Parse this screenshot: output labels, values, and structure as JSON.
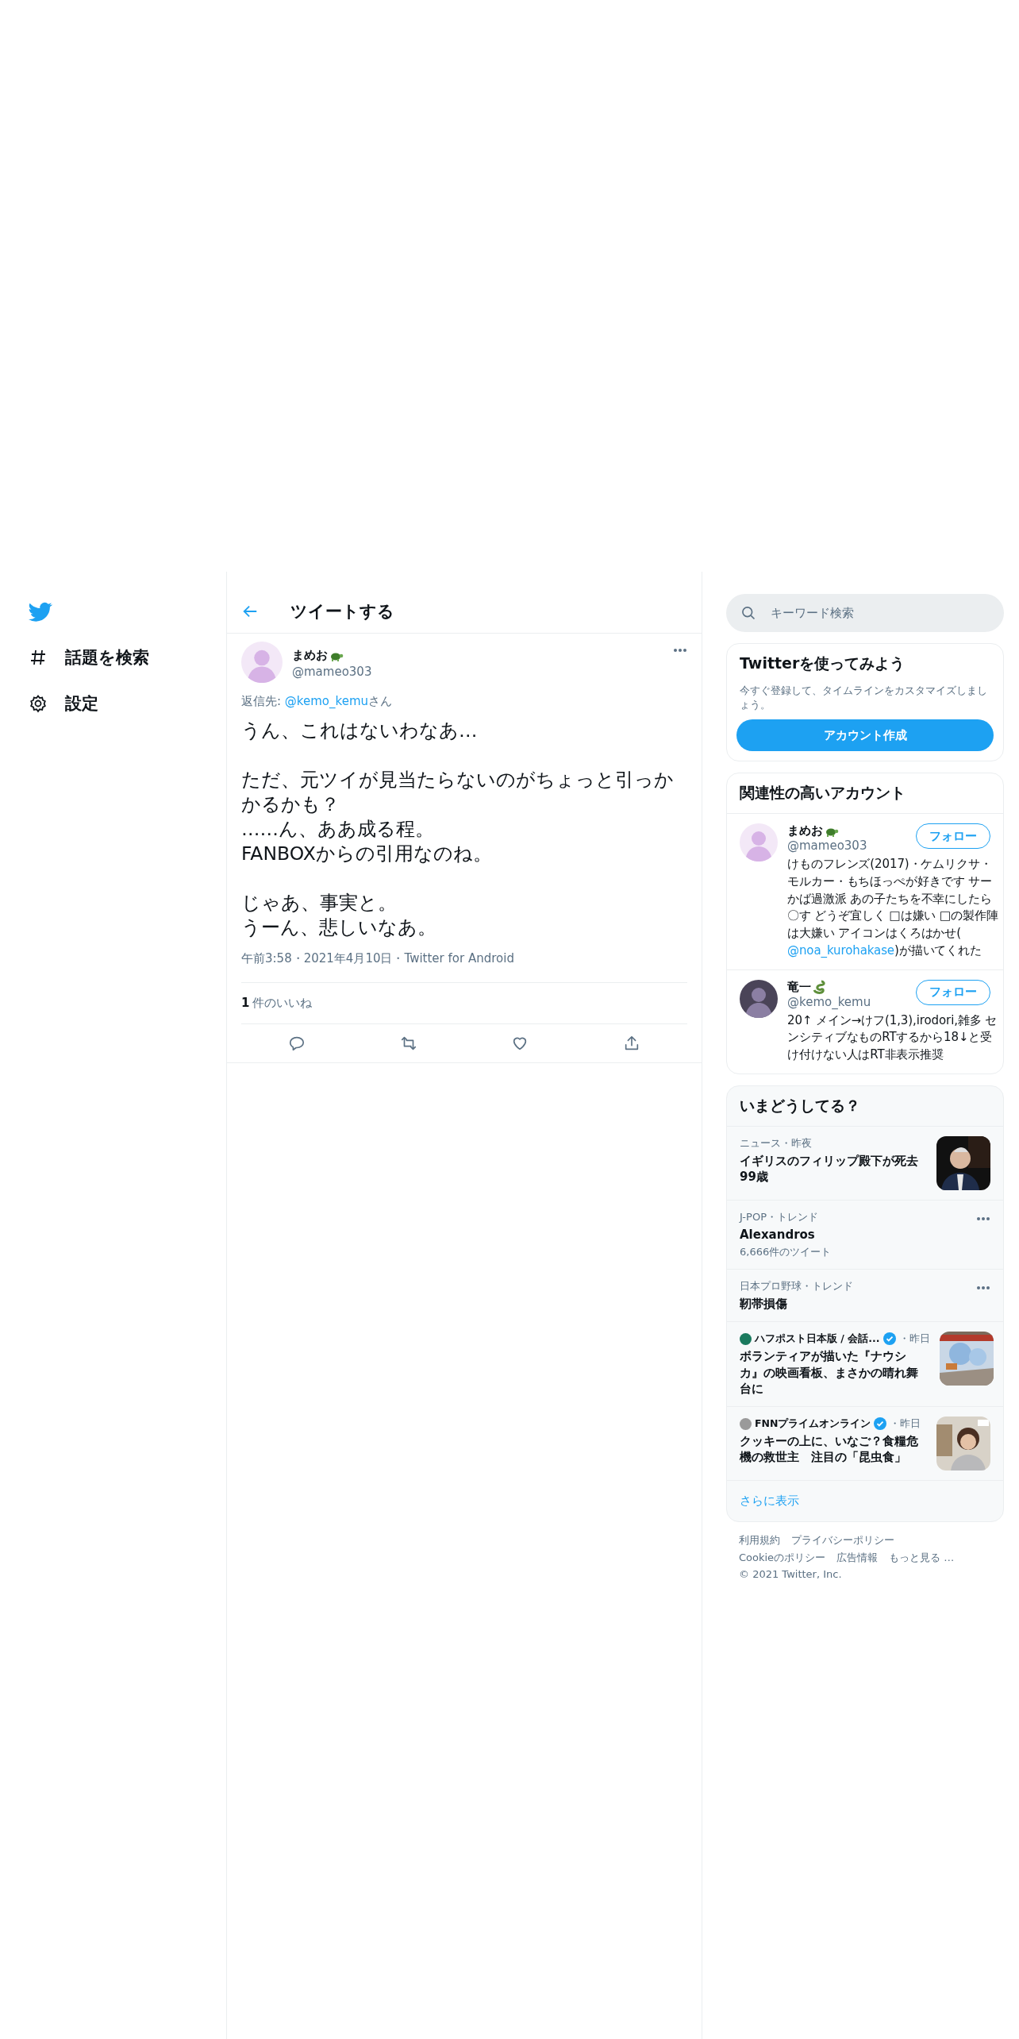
{
  "nav": {
    "items": [
      {
        "kind": "hashtag",
        "label": "話題を検索"
      },
      {
        "kind": "gear",
        "label": "設定"
      }
    ]
  },
  "header": {
    "title": "ツイートする"
  },
  "tweet": {
    "author": {
      "name": "まめお",
      "handle": "@mameo303"
    },
    "reply_to": {
      "prefix": "返信先: ",
      "handle": "@kemo_kemu",
      "suffix": "さん"
    },
    "paragraphs": [
      [
        "うん、これはないわなあ…"
      ],
      [
        "ただ、元ツイが見当たらないのがちょっと引っかかるかも？",
        "……ん、ああ成る程。",
        "FANBOXからの引用なのね。"
      ],
      [
        "じゃあ、事実と。",
        "うーん、悲しいなあ。"
      ]
    ],
    "meta": "午前3:58・2021年4月10日・Twitter for Android",
    "likes": {
      "count": "1",
      "label": "件のいいね"
    }
  },
  "search": {
    "placeholder": "キーワード検索"
  },
  "signup": {
    "title": "Twitterを使ってみよう",
    "text": "今すぐ登録して、タイムラインをカスタマイズしましょう。",
    "button": "アカウント作成"
  },
  "related": {
    "title": "関連性の高いアカウント",
    "accounts": [
      {
        "name": "まめお",
        "handle": "@mameo303",
        "follow": "フォロー",
        "bio": {
          "text": "けものフレンズ(2017)・ケムリクサ・モルカー・もちほっぺが好きです サーかば過激派 あの子たちを不幸にしたら〇す どうぞ宜しく □は嫌い □の製作陣は大嫌い アイコンはくろはかせ(",
          "mention": "@noa_kurohakase",
          "after": ")が描いてくれた"
        }
      },
      {
        "name": "竜一",
        "handle": "@kemo_kemu",
        "follow": "フォロー",
        "bio": {
          "text": "20↑ メイン→けフ(1,3),irodori,雑多 センシティブなものRTするから18↓と受け付けない人はRT非表示推奨"
        }
      }
    ]
  },
  "trends": {
    "title": "いまどうしてる？",
    "items": [
      {
        "kind": "news",
        "context": "ニュース・昨夜",
        "title": "イギリスのフィリップ殿下が死去 99歳"
      },
      {
        "kind": "trend",
        "context": "J-POP・トレンド",
        "title": "Alexandros",
        "count": "6,666件のツイート"
      },
      {
        "kind": "trend",
        "context": "日本プロ野球・トレンド",
        "title": "靭帯損傷"
      },
      {
        "kind": "article",
        "source": "ハフポスト日本版 / 会話...",
        "color": "#1a7a5e",
        "verified": true,
        "time": "・昨日",
        "title": "ボランティアが描いた『ナウシカ』の映画看板、まさかの晴れ舞台に"
      },
      {
        "kind": "article",
        "source": "FNNプライムオンライン",
        "color": "#9a9a9a",
        "verified": true,
        "time": "・昨日",
        "title": "クッキーの上に、いなご？食糧危機の救世主　注目の「昆虫食」"
      }
    ],
    "more": "さらに表示"
  },
  "footer": {
    "rows": [
      [
        "利用規約",
        "プライバシーポリシー"
      ],
      [
        "Cookieのポリシー",
        "広告情報",
        "もっと見る …"
      ]
    ],
    "copyright": "© 2021 Twitter, Inc."
  }
}
